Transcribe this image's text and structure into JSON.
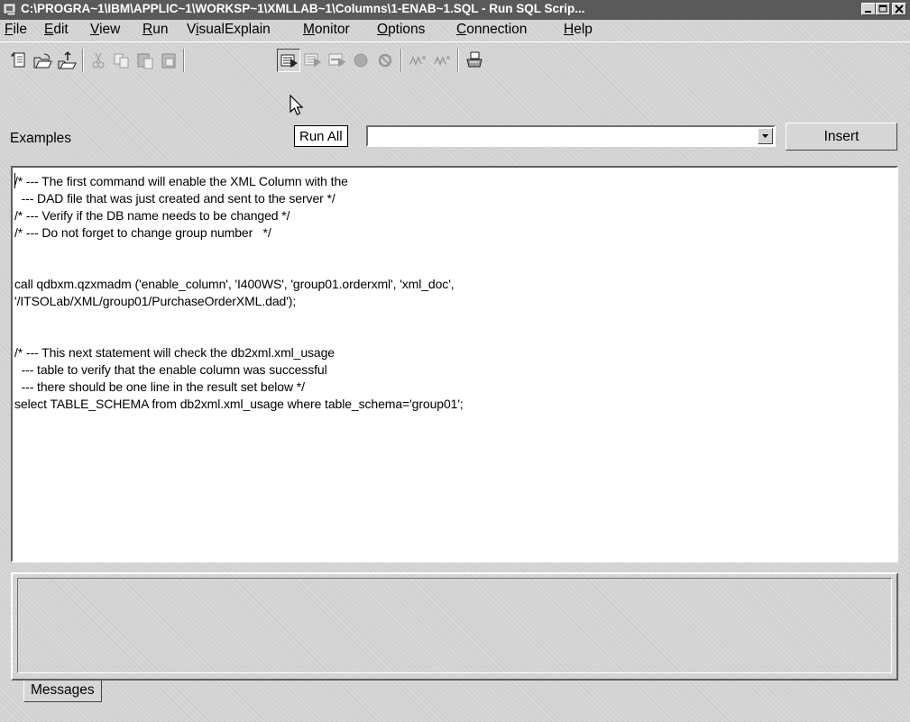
{
  "window": {
    "title": "C:\\PROGRA~1\\IBM\\APPLIC~1\\WORKSP~1\\XMLLAB~1\\Columns\\1-ENAB~1.SQL - Run SQL Scrip..."
  },
  "menu": {
    "items": [
      {
        "mn": "F",
        "rest": "ile"
      },
      {
        "mn": "E",
        "rest": "dit"
      },
      {
        "mn": "V",
        "rest": "iew"
      },
      {
        "mn": "R",
        "rest": "un"
      },
      {
        "pre": "V",
        "mn": "i",
        "rest": "sualExplain"
      },
      {
        "mn": "M",
        "rest": "onitor"
      },
      {
        "mn": "O",
        "rest": "ptions"
      },
      {
        "mn": "C",
        "rest": "onnection"
      },
      {
        "mn": "H",
        "rest": "elp"
      }
    ]
  },
  "toolbar": {
    "icons": [
      "new-file-icon",
      "open-file-icon",
      "save-file-icon",
      "cut-icon",
      "copy-icon",
      "paste-icon",
      "paste-special-icon",
      "run-all-icon",
      "run-from-selected-icon",
      "run-selected-icon",
      "stop-icon",
      "cancel-icon",
      "smart-explain-icon",
      "explain-icon",
      "print-icon"
    ]
  },
  "examples": {
    "label": "Examples",
    "selected": "",
    "insert_label": "Insert"
  },
  "tooltip": "Run All",
  "editor": {
    "lines": [
      "/* --- The first command will enable the XML Column with the",
      "  --- DAD file that was just created and sent to the server */",
      "/* --- Verify if the DB name needs to be changed */",
      "/* --- Do not forget to change group number   */",
      "",
      "call qdbxm.qzxmadm ('enable_column', 'I400WS', 'group01.orderxml', 'xml_doc',",
      "'/ITSOLab/XML/group01/PurchaseOrderXML.dad');",
      "",
      "/* --- This next statement will check the db2xml.xml_usage",
      "  --- table to verify that the enable column was successful",
      "  --- there should be one line in the result set below */",
      "select TABLE_SCHEMA from db2xml.xml_usage where table_schema='group01';"
    ]
  },
  "messages": {
    "tab_label": "Messages"
  },
  "colors": {
    "titlebar": "#5a5a5a",
    "window_bg": "#d6d6d6",
    "editor_bg": "#ffffff"
  }
}
